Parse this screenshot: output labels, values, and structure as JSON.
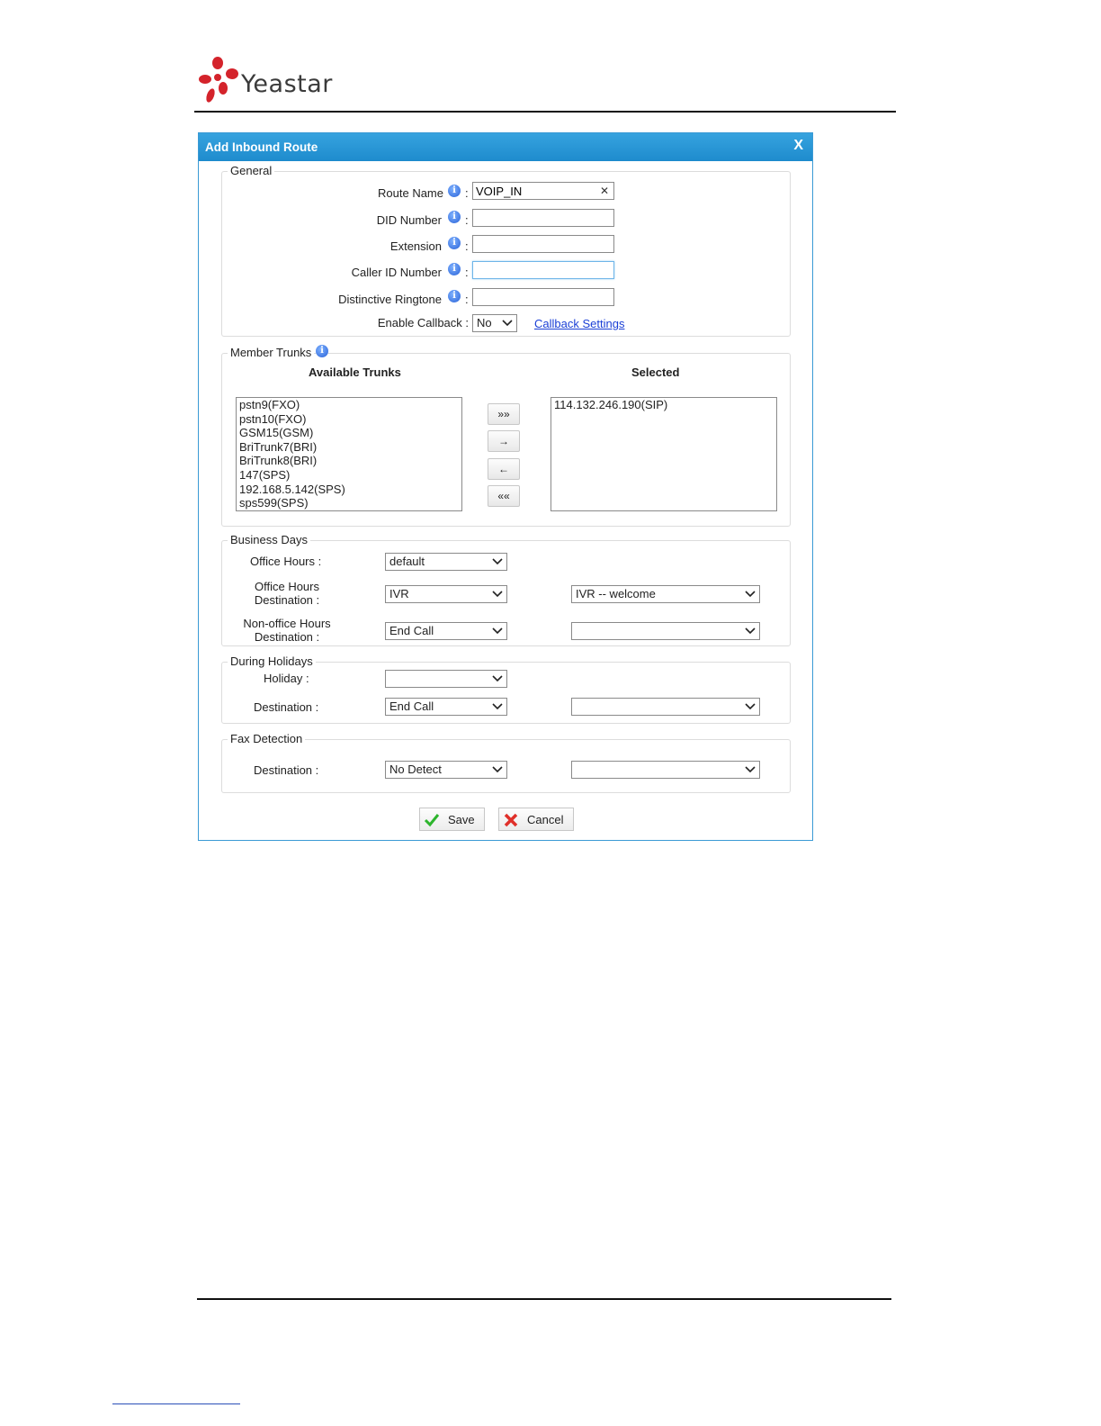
{
  "header": {
    "logo_text": "Yeastar"
  },
  "dialog": {
    "title": "Add Inbound Route",
    "close_label": "X",
    "general": {
      "legend": "General",
      "route_name": {
        "label": "Route Name",
        "value": "VOIP_IN"
      },
      "did_number": {
        "label": "DID Number",
        "value": ""
      },
      "extension": {
        "label": "Extension",
        "value": ""
      },
      "caller_id_number": {
        "label": "Caller ID Number",
        "value": ""
      },
      "distinctive_ringtone": {
        "label": "Distinctive Ringtone",
        "value": ""
      },
      "enable_callback": {
        "label": "Enable Callback :",
        "value": "No"
      },
      "callback_settings_link": "Callback Settings",
      "colon": ":"
    },
    "member_trunks": {
      "legend": "Member Trunks",
      "available_header": "Available Trunks",
      "selected_header": "Selected",
      "available": [
        "pstn9(FXO)",
        "pstn10(FXO)",
        "GSM15(GSM)",
        "BriTrunk7(BRI)",
        "BriTrunk8(BRI)",
        "147(SPS)",
        "192.168.5.142(SPS)",
        "sps599(SPS)"
      ],
      "selected": [
        "114.132.246.190(SIP)"
      ],
      "buttons": {
        "add_all": "»»",
        "add": "→",
        "remove": "←",
        "remove_all": "««"
      }
    },
    "business_days": {
      "legend": "Business Days",
      "office_hours": {
        "label": "Office Hours :",
        "value": "default"
      },
      "office_hours_destination": {
        "label_line1": "Office Hours",
        "label_line2": "Destination :",
        "type": "IVR",
        "target": "IVR -- welcome"
      },
      "non_office_hours_destination": {
        "label_line1": "Non-office Hours",
        "label_line2": "Destination :",
        "type": "End Call",
        "target": ""
      }
    },
    "holidays": {
      "legend": "During Holidays",
      "holiday": {
        "label": "Holiday :",
        "value": ""
      },
      "destination": {
        "label": "Destination :",
        "type": "End Call",
        "target": ""
      }
    },
    "fax": {
      "legend": "Fax Detection",
      "destination": {
        "label": "Destination :",
        "type": "No Detect",
        "target": ""
      }
    },
    "save_label": "Save",
    "cancel_label": "Cancel"
  }
}
